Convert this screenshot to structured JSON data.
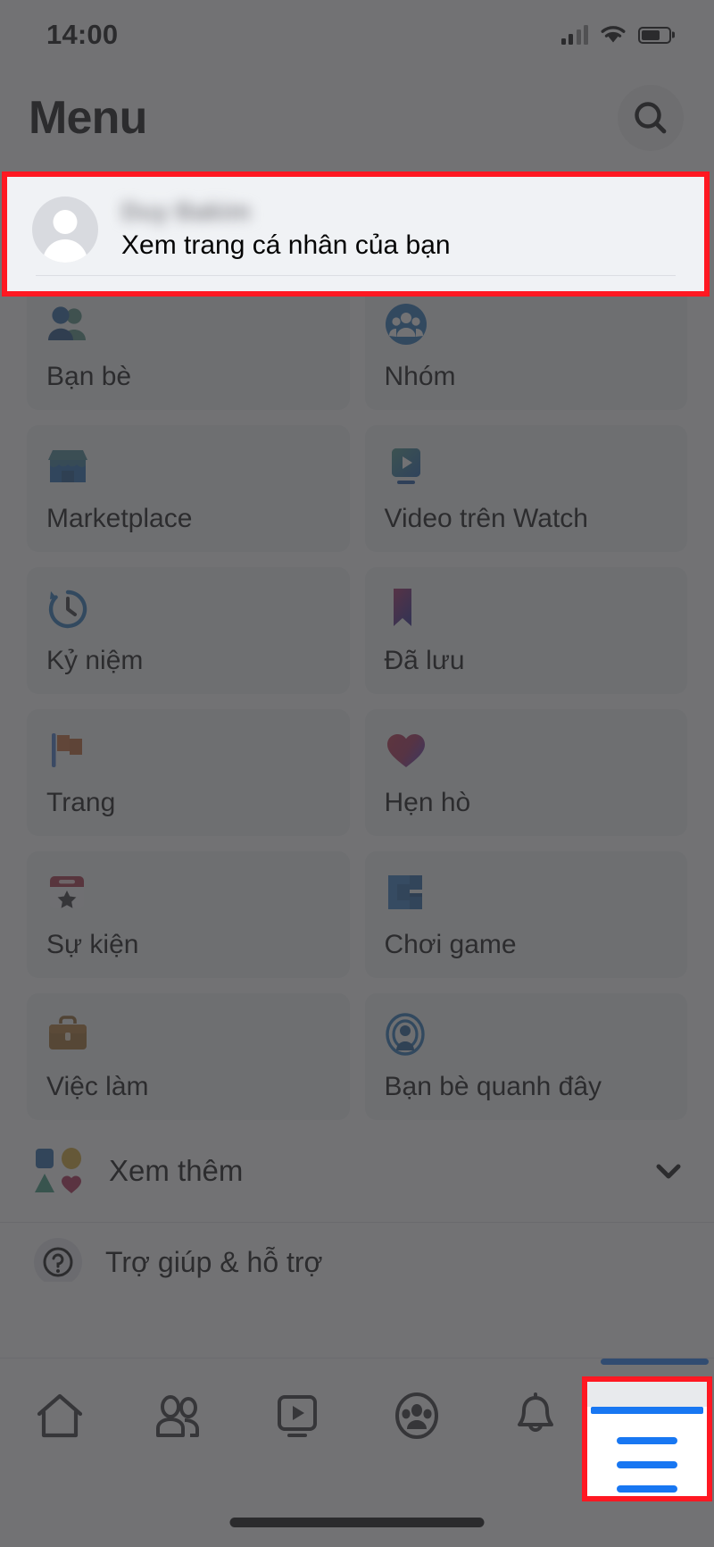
{
  "status_bar": {
    "time": "14:00",
    "signal_icon": "cellular-signal-icon",
    "wifi_icon": "wifi-icon",
    "battery_icon": "battery-icon"
  },
  "header": {
    "title": "Menu",
    "search_icon": "search-icon"
  },
  "profile": {
    "name": "Duy Bakim",
    "subtitle": "Xem trang cá nhân của bạn",
    "avatar_icon": "avatar-placeholder-icon"
  },
  "menu_tiles": [
    {
      "label": "Bạn bè",
      "icon": "friends-icon"
    },
    {
      "label": "Nhóm",
      "icon": "groups-icon"
    },
    {
      "label": "Marketplace",
      "icon": "marketplace-icon"
    },
    {
      "label": "Video trên Watch",
      "icon": "watch-video-icon"
    },
    {
      "label": "Kỷ niệm",
      "icon": "memories-clock-icon"
    },
    {
      "label": "Đã lưu",
      "icon": "saved-bookmark-icon"
    },
    {
      "label": "Trang",
      "icon": "pages-flag-icon"
    },
    {
      "label": "Hẹn hò",
      "icon": "dating-heart-icon"
    },
    {
      "label": "Sự kiện",
      "icon": "events-calendar-icon"
    },
    {
      "label": "Chơi game",
      "icon": "gaming-icon"
    },
    {
      "label": "Việc làm",
      "icon": "jobs-briefcase-icon"
    },
    {
      "label": "Bạn bè quanh đây",
      "icon": "nearby-friends-icon"
    }
  ],
  "see_more": {
    "label": "Xem thêm",
    "icon": "shapes-icon",
    "chevron_icon": "chevron-down-icon"
  },
  "partial_row": {
    "label": "Trợ giúp & hỗ trợ",
    "icon": "help-support-icon"
  },
  "bottom_nav": [
    {
      "name": "home",
      "icon": "home-icon",
      "active": false
    },
    {
      "name": "friends",
      "icon": "friends-outline-icon",
      "active": false
    },
    {
      "name": "watch",
      "icon": "watch-outline-icon",
      "active": false
    },
    {
      "name": "groups",
      "icon": "groups-outline-icon",
      "active": false
    },
    {
      "name": "notifications",
      "icon": "bell-icon",
      "active": false
    },
    {
      "name": "menu",
      "icon": "hamburger-menu-icon",
      "active": true
    }
  ],
  "colors": {
    "highlight_red": "#FF1822",
    "facebook_blue": "#1877F2",
    "tile_bg": "#F0F2F5",
    "dim_overlay": "rgba(60,60,62,0.72)"
  }
}
